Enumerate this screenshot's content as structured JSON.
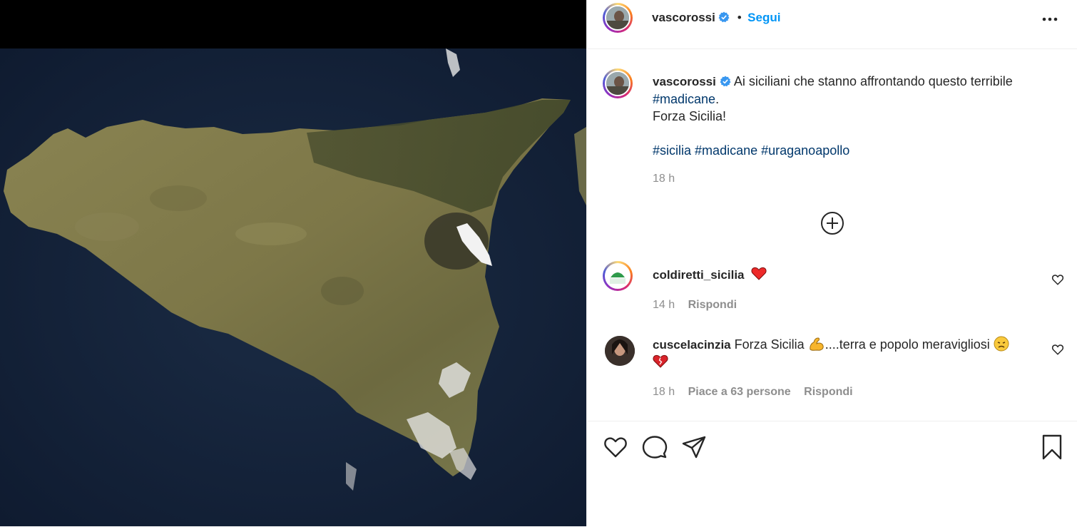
{
  "post": {
    "author": "vascorossi",
    "follow_label": "Segui",
    "more_label": "•••",
    "dot": "•"
  },
  "caption": {
    "author": "vascorossi",
    "text1": "Ai siciliani che stanno affrontando questo terribile",
    "tag_madicane": "#madicane",
    "text1_end": ".",
    "line2": "Forza Sicilia!",
    "tags": [
      "#sicilia",
      "#madicane",
      "#uraganoapollo"
    ],
    "time": "18 h"
  },
  "comments": [
    {
      "author": "coldiretti_sicilia",
      "text": "",
      "emoji": "heart",
      "time": "14 h",
      "reply": "Rispondi",
      "avatar_text": "COLDIRETTI SICILIA"
    },
    {
      "author": "cuscelacinzia",
      "text1": "Forza Sicilia",
      "text2": "....terra e popolo meravigliosi",
      "time": "18 h",
      "likes": "Piace a 63 persone",
      "reply": "Rispondi"
    }
  ],
  "icons": {
    "like": "heart-icon",
    "comment": "comment-icon",
    "share": "share-icon",
    "save": "bookmark-icon",
    "load_more": "plus-circle-icon",
    "verified": "verified-badge-icon"
  },
  "colors": {
    "link": "#0095f6",
    "hashtag": "#00376b",
    "secondary": "#8e8e8e",
    "heart": "#ed4956"
  }
}
